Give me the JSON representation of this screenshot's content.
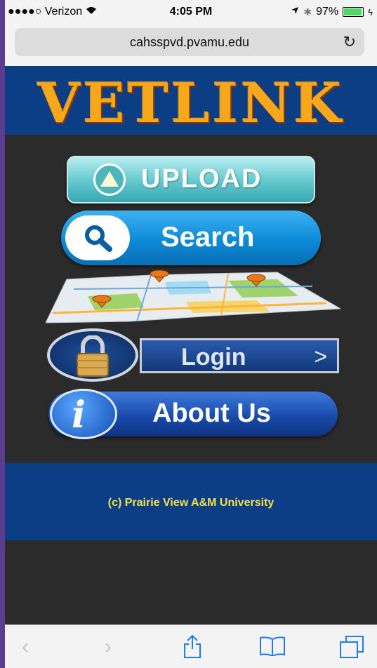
{
  "status_bar": {
    "carrier": "●●●●○ Verizon",
    "time": "4:05 PM",
    "battery": "97%",
    "battery_level": 0.97
  },
  "browser": {
    "url": "cahsspvd.pvamu.edu"
  },
  "header": {
    "logo_text": "VETLINK"
  },
  "menu": {
    "upload_label": "UPLOAD",
    "search_label": "Search",
    "login_label": "Login",
    "login_arrow": ">",
    "about_label": "About Us"
  },
  "footer": {
    "copyright": "(c) Prairie View A&M University"
  },
  "colors": {
    "header_blue": "#0c3e86",
    "page_bg": "#2b2b2b",
    "footer_text": "#f5e04a",
    "ios_blue": "#1d7cf2"
  }
}
